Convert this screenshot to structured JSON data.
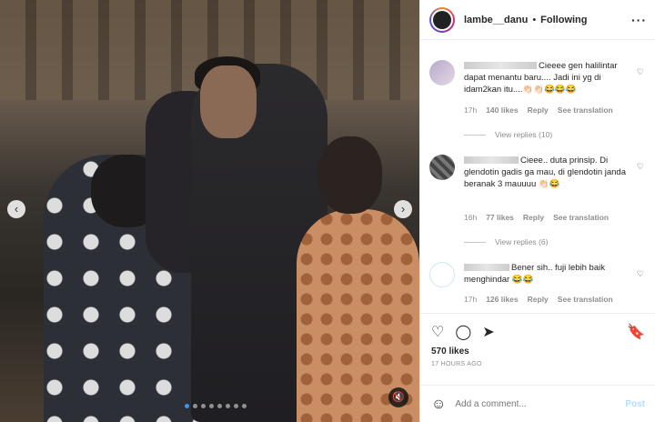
{
  "header": {
    "username": "lambe__danu",
    "separator": "•",
    "follow_status": "Following",
    "more_icon": "more-horizontal-icon"
  },
  "media": {
    "left_nav_icon": "chevron-left-icon",
    "right_nav_icon": "chevron-right-icon",
    "mute_icon": "speaker-muted-icon",
    "carousel_count": 8,
    "carousel_active_index": 0
  },
  "comments": [
    {
      "text": "Cieeee gen halilintar dapat menantu baru.... Jadi ini yg di idam2kan itu....👏🏻👏🏻😂😂😂",
      "time": "17h",
      "likes": "140 likes",
      "reply": "Reply",
      "translate": "See translation",
      "replies": "View replies (10)"
    },
    {
      "text": "Cieee.. duta prinsip. Di glendotin gadis ga mau, di glendotin janda beranak 3 mauuuu 👏🏻😂",
      "time": "16h",
      "likes": "77 likes",
      "reply": "Reply",
      "translate": "See translation",
      "replies": "View replies (6)"
    },
    {
      "text": "Bener sih.. fuji lebih baik menghindar 😂😂",
      "time": "17h",
      "likes": "126 likes",
      "reply": "Reply",
      "translate": "See translation"
    }
  ],
  "actions": {
    "like_icon": "heart-icon",
    "comment_icon": "comment-icon",
    "share_icon": "send-icon",
    "save_icon": "bookmark-icon",
    "likes": "570 likes",
    "time_ago": "17 HOURS AGO"
  },
  "composer": {
    "emoji_icon": "emoji-icon",
    "placeholder": "Add a comment...",
    "post_label": "Post"
  },
  "colors": {
    "accent": "#3897f0",
    "post_disabled": "#b2dffc",
    "muted_text": "#8e8e8e"
  }
}
